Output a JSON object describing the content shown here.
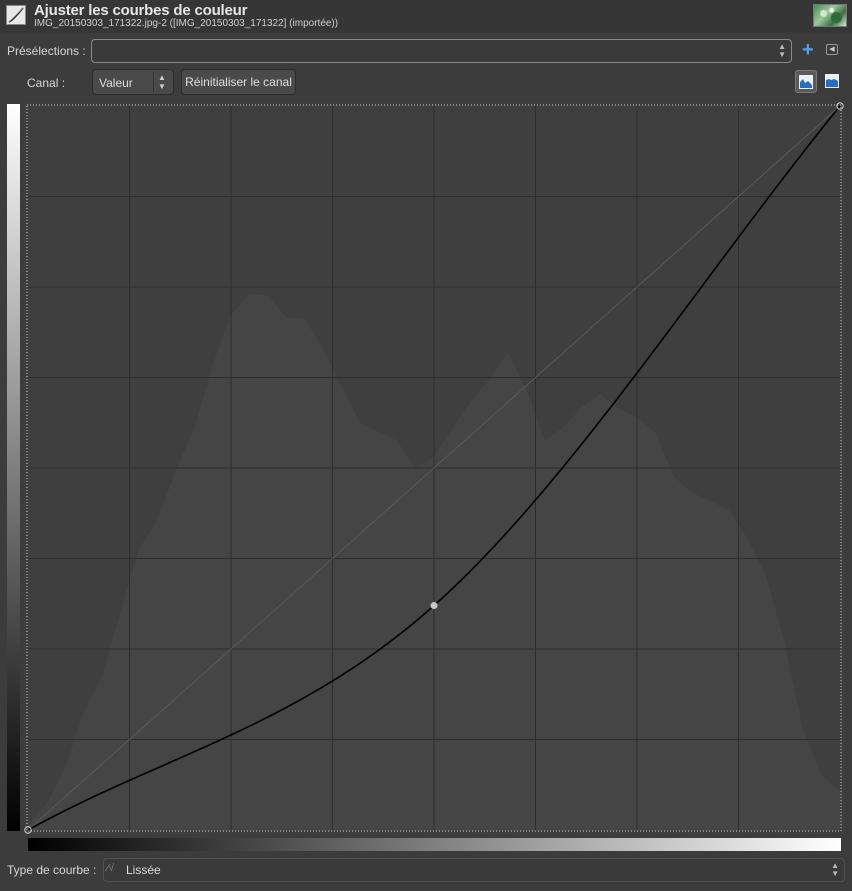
{
  "header": {
    "title": "Ajuster les courbes de couleur",
    "subtitle": "IMG_20150303_171322.jpg-2 ([IMG_20150303_171322] (importée))"
  },
  "presets": {
    "label": "Présélections :",
    "value": ""
  },
  "channel": {
    "label": "Canal :",
    "value": "Valeur",
    "reset_label": "Réinitialiser le canal",
    "histogram_scale": "linear"
  },
  "curve": {
    "control_points": [
      [
        0,
        0
      ],
      [
        0.5,
        0.31
      ],
      [
        1,
        1
      ]
    ],
    "histogram_profile": [
      0.02,
      0.04,
      0.08,
      0.15,
      0.22,
      0.3,
      0.38,
      0.44,
      0.5,
      0.55,
      0.63,
      0.72,
      0.74,
      0.73,
      0.72,
      0.71,
      0.66,
      0.6,
      0.57,
      0.55,
      0.53,
      0.51,
      0.52,
      0.55,
      0.58,
      0.63,
      0.66,
      0.6,
      0.55,
      0.56,
      0.58,
      0.59,
      0.59,
      0.57,
      0.54,
      0.5,
      0.47,
      0.45,
      0.43,
      0.41,
      0.35,
      0.25,
      0.15,
      0.08,
      0.05
    ]
  },
  "curve_type": {
    "label": "Type de courbe :",
    "icon": "smooth-curve-icon",
    "value": "Lissée"
  },
  "colors": {
    "curve": "#000000",
    "grid": "#2d2d2d",
    "histogram": "#454545",
    "plot_bg": "#3f3f3f",
    "accent": "#5aa0e8"
  }
}
